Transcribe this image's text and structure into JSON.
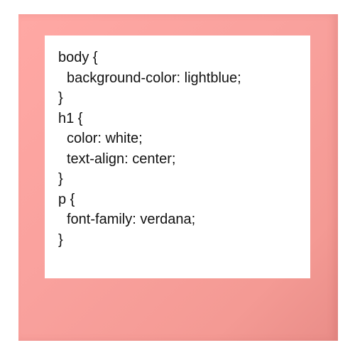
{
  "code": {
    "lines": [
      "body {",
      "background-color: lightblue;",
      "}",
      "h1 {",
      "color: white;",
      "text-align: center;",
      "}",
      "p {",
      "font-family: verdana;",
      "}"
    ]
  },
  "colors": {
    "frame": "#f9a19d",
    "card": "#ffffff",
    "text": "#111111"
  }
}
